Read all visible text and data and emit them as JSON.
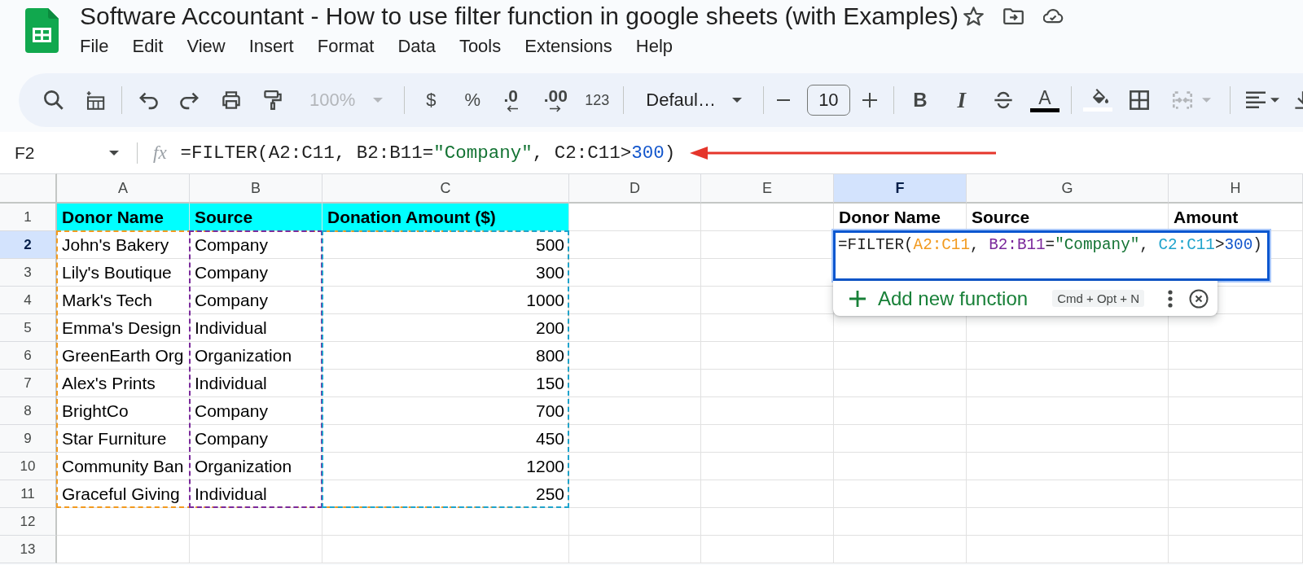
{
  "document": {
    "title": "Software Accountant - How to use filter function in google sheets (with Examples)"
  },
  "menu": [
    "File",
    "Edit",
    "View",
    "Insert",
    "Format",
    "Data",
    "Tools",
    "Extensions",
    "Help"
  ],
  "toolbar": {
    "zoom": {
      "value": "100%",
      "disabled": true
    },
    "number_formats": [
      {
        "label": "$",
        "kind": "plain"
      },
      {
        "label": "%",
        "kind": "plain"
      },
      {
        "label": ".0",
        "kind": "decrease"
      },
      {
        "label": ".00",
        "kind": "increase"
      },
      {
        "label": "123",
        "kind": "plain"
      }
    ],
    "font": {
      "value": "Defaul…"
    },
    "font_size": {
      "value": "10"
    },
    "bold": "B",
    "italic": "I",
    "text_color": "A",
    "merge": {
      "disabled": true
    }
  },
  "formula_bar": {
    "name_box": "F2",
    "fx": "fx",
    "tokens": [
      {
        "text": "=FILTER(A2:C11, B2:B11=",
        "kind": "plain"
      },
      {
        "text": "\"Company\"",
        "kind": "string"
      },
      {
        "text": ", C2:C11>",
        "kind": "plain"
      },
      {
        "text": "300",
        "kind": "number"
      },
      {
        "text": ")",
        "kind": "plain"
      }
    ]
  },
  "sheet": {
    "columns": [
      {
        "label": "A",
        "selected": false
      },
      {
        "label": "B",
        "selected": false
      },
      {
        "label": "C",
        "selected": false
      },
      {
        "label": "D",
        "selected": false
      },
      {
        "label": "E",
        "selected": false
      },
      {
        "label": "F",
        "selected": true
      },
      {
        "label": "G",
        "selected": false
      },
      {
        "label": "H",
        "selected": false
      }
    ],
    "rows": [
      {
        "label": "1",
        "selected": false
      },
      {
        "label": "2",
        "selected": true
      },
      {
        "label": "3",
        "selected": false
      },
      {
        "label": "4",
        "selected": false
      },
      {
        "label": "5",
        "selected": false
      },
      {
        "label": "6",
        "selected": false
      },
      {
        "label": "7",
        "selected": false
      },
      {
        "label": "8",
        "selected": false
      },
      {
        "label": "9",
        "selected": false
      },
      {
        "label": "10",
        "selected": false
      },
      {
        "label": "11",
        "selected": false
      },
      {
        "label": "12",
        "selected": false
      },
      {
        "label": "13",
        "selected": false
      }
    ],
    "source_table": {
      "columns": [
        {
          "header": "Donor Name",
          "kind": "text"
        },
        {
          "header": "Source",
          "kind": "text"
        },
        {
          "header": "Donation Amount ($)",
          "kind": "number"
        }
      ],
      "rows": [
        [
          "John's Bakery",
          "Company",
          "500"
        ],
        [
          "Lily's Boutique",
          "Company",
          "300"
        ],
        [
          "Mark's Tech",
          "Company",
          "1000"
        ],
        [
          "Emma's Design",
          "Individual",
          "200"
        ],
        [
          "GreenEarth Org",
          "Organization",
          "800"
        ],
        [
          "Alex's Prints",
          "Individual",
          "150"
        ],
        [
          "BrightCo",
          "Company",
          "700"
        ],
        [
          "Star Furniture",
          "Company",
          "450"
        ],
        [
          "Community Ban",
          "Organization",
          "1200"
        ],
        [
          "Graceful Giving",
          "Individual",
          "250"
        ]
      ]
    },
    "result_table": {
      "headers": [
        "Donor Name",
        "Source",
        "Amount"
      ]
    },
    "cell_editor": {
      "tokens": [
        {
          "text": "=FILTER(",
          "kind": "plain"
        },
        {
          "text": "A2:C11",
          "kind": "range",
          "color": "#f29a1f"
        },
        {
          "text": ", ",
          "kind": "plain"
        },
        {
          "text": "B2:B11",
          "kind": "range",
          "color": "#7b2a9c"
        },
        {
          "text": "=",
          "kind": "plain"
        },
        {
          "text": "\"Company\"",
          "kind": "string"
        },
        {
          "text": ", ",
          "kind": "plain"
        },
        {
          "text": "C2:C11",
          "kind": "range",
          "color": "#1fa3cc"
        },
        {
          "text": ">",
          "kind": "plain"
        },
        {
          "text": "300",
          "kind": "number"
        },
        {
          "text": ")",
          "kind": "plain"
        }
      ]
    },
    "function_hint": {
      "label": "Add new function",
      "shortcut": "Cmd + Opt + N"
    }
  }
}
